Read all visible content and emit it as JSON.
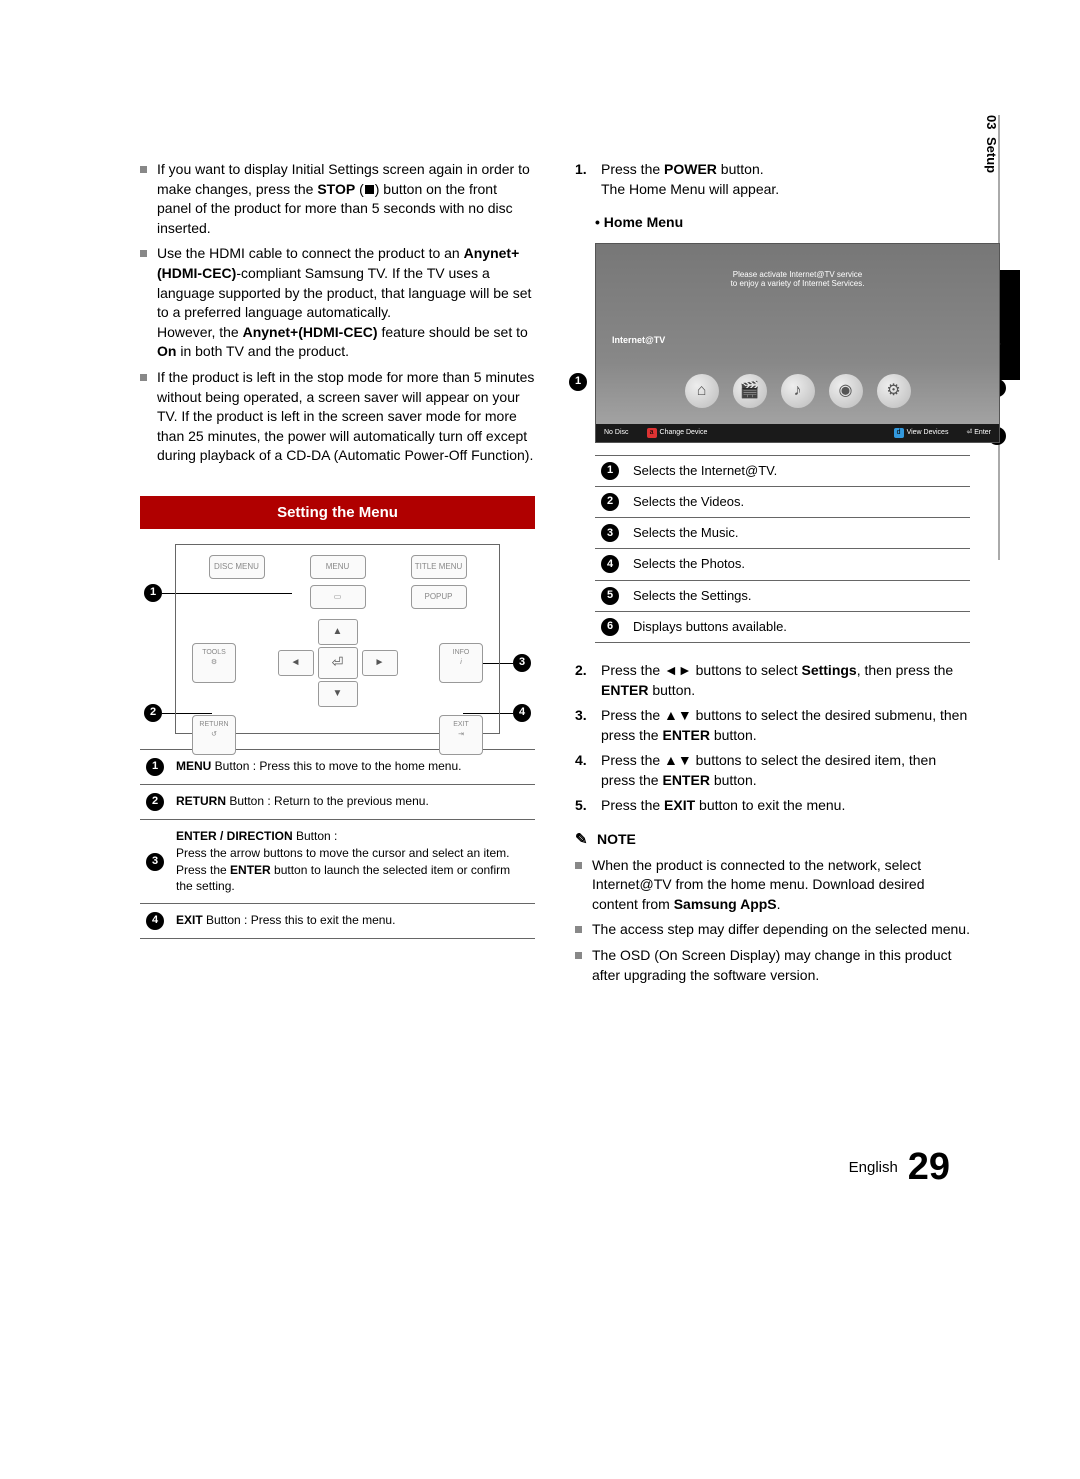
{
  "side_tab": {
    "num": "03",
    "section": "Setup"
  },
  "left_bullets": {
    "b1": "If you want to display Initial Settings screen again in order to make changes, press the",
    "b1_bold": "STOP",
    "b1_cont": " button on the front panel of the product for more than 5 seconds with no disc inserted.",
    "b2a": "Use the HDMI cable to connect the product to an ",
    "b2_bold1": "Anynet+(HDMI-CEC)",
    "b2b": "-compliant Samsung TV. If the TV uses a language supported by the product, that language will be set to a preferred language automatically.\nHowever, the ",
    "b2_bold2": "Anynet+(HDMI-CEC)",
    "b2c": " feature should be set to ",
    "b2_bold3": "On",
    "b2d": " in both TV and the product.",
    "b3": "If the product is left in the stop mode for more than 5 minutes without being operated, a screen saver will appear on your TV. If the product is left in the screen saver mode for more than 25 minutes, the power will automatically turn off except during playback of a CD-DA (Automatic Power-Off Function)."
  },
  "section_header": "Setting the Menu",
  "remote_labels": {
    "disc_menu": "DISC MENU",
    "menu": "MENU",
    "title_menu": "TITLE MENU",
    "popup": "POPUP",
    "tools": "TOOLS",
    "info": "INFO",
    "return": "RETURN",
    "exit": "EXIT"
  },
  "remote_table": {
    "r1_bold": "MENU",
    "r1": " Button : Press this to move to the home menu.",
    "r2_bold": "RETURN",
    "r2": " Button : Return to the previous menu.",
    "r3_bold": "ENTER / DIRECTION",
    "r3_a": " Button :",
    "r3_b": "Press the arrow buttons to move the cursor and select an item.",
    "r3_c": "Press the ",
    "r3_c_bold": "ENTER",
    "r3_d": " button to launch the selected item or confirm the setting.",
    "r4_bold": "EXIT",
    "r4": " Button : Press this to exit the menu."
  },
  "steps": {
    "s1a": "Press the ",
    "s1_bold": "POWER",
    "s1b": " button.\nThe Home Menu will appear.",
    "home_menu_label": "Home Menu",
    "s2a": "Press the ◄► buttons to select ",
    "s2_bold1": "Settings",
    "s2b": ", then press the ",
    "s2_bold2": "ENTER",
    "s2c": " button.",
    "s3a": "Press the ▲▼ buttons to select the desired submenu, then press the ",
    "s3_bold": "ENTER",
    "s3b": " button.",
    "s4a": "Press the ▲▼ buttons to select the desired item, then press the ",
    "s4_bold": "ENTER",
    "s4b": " button.",
    "s5a": "Press the ",
    "s5_bold": "EXIT",
    "s5b": " button to exit the menu."
  },
  "hm_diagram": {
    "banner1": "Please activate Internet@TV service",
    "banner2": "to enjoy a variety of Internet Services.",
    "label": "Internet@TV",
    "bar_nodisc": "No Disc",
    "bar_change": "Change Device",
    "bar_view": "View Devices",
    "bar_enter": "Enter"
  },
  "legend": {
    "l1": "Selects the Internet@TV.",
    "l2": "Selects the Videos.",
    "l3": "Selects the Music.",
    "l4": "Selects the Photos.",
    "l5": "Selects the Settings.",
    "l6": "Displays buttons available."
  },
  "note_label": "NOTE",
  "notes": {
    "n1a": "When the product is connected to the network, select Internet@TV from the home menu. Download desired content from ",
    "n1_bold": "Samsung AppS",
    "n1b": ".",
    "n2": "The access step may differ depending on the selected menu.",
    "n3": "The OSD (On Screen Display) may change in this product after upgrading the software version."
  },
  "footer": {
    "lang": "English",
    "page": "29"
  },
  "numbers": {
    "n1": "1",
    "n2": "2",
    "n3": "3",
    "n4": "4",
    "n5": "5",
    "n6": "6"
  }
}
